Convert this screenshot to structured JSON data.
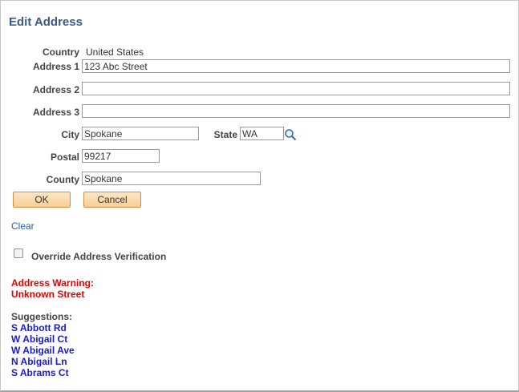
{
  "title": "Edit Address",
  "country": {
    "label": "Country",
    "value": "United States"
  },
  "address1": {
    "label": "Address 1",
    "value": "123 Abc Street"
  },
  "address2": {
    "label": "Address 2",
    "value": ""
  },
  "address3": {
    "label": "Address 3",
    "value": ""
  },
  "city": {
    "label": "City",
    "value": "Spokane"
  },
  "state": {
    "label": "State",
    "value": "WA",
    "lookup_icon": "magnifier-lookup-icon"
  },
  "postal": {
    "label": "Postal",
    "value": "99217"
  },
  "county": {
    "label": "County",
    "value": "Spokane"
  },
  "buttons": {
    "ok": "OK",
    "cancel": "Cancel"
  },
  "clear_link": "Clear",
  "override": {
    "label": "Override Address Verification",
    "checked": false
  },
  "warning": {
    "line1": "Address Warning:",
    "line2": "Unknown Street"
  },
  "suggestions": {
    "title": "Suggestions:",
    "items": [
      "S Abbott Rd",
      "W Abigail Ct",
      "W Abigail Ave",
      "N Abigail Ln",
      "S Abrams Ct"
    ]
  },
  "colors": {
    "title": "#3a5a86",
    "warning": "#e00000",
    "suggestion": "#1a1acc",
    "link": "#255e96",
    "button": "#f7cf94"
  }
}
